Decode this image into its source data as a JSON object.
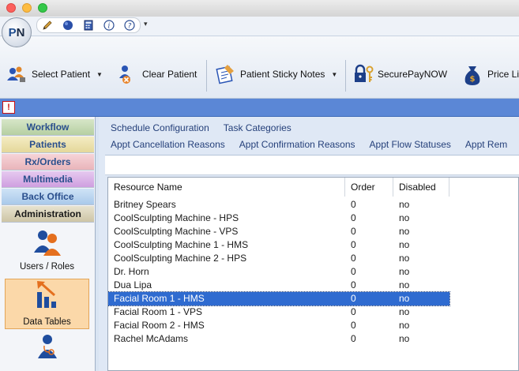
{
  "quick_access": {
    "icons": [
      "pen-icon",
      "globe-icon",
      "calculator-icon",
      "info-icon",
      "help-icon"
    ]
  },
  "ribbon": {
    "buttons": [
      {
        "label": "Select Patient",
        "icon": "select-patient-icon",
        "has_dropdown": true
      },
      {
        "label": "Clear Patient",
        "icon": "clear-patient-icon",
        "has_dropdown": false
      },
      {
        "label": "Patient Sticky Notes",
        "icon": "sticky-notes-icon",
        "has_dropdown": true
      },
      {
        "label": "SecurePayNOW",
        "icon": "lock-key-icon",
        "has_dropdown": false
      },
      {
        "label": "Price Li",
        "icon": "money-bag-icon",
        "has_dropdown": false
      }
    ]
  },
  "nav": {
    "sections": [
      "Workflow",
      "Patients",
      "Rx/Orders",
      "Multimedia",
      "Back Office",
      "Administration"
    ],
    "items": [
      {
        "label": "Users / Roles",
        "icon": "users-icon"
      },
      {
        "label": "Data Tables",
        "icon": "data-tables-icon",
        "selected": true
      },
      {
        "label": "",
        "icon": "provider-icon"
      }
    ]
  },
  "tabs": {
    "row1": [
      "Schedule Configuration",
      "Task Categories"
    ],
    "row2": [
      "Appt Cancellation Reasons",
      "Appt Confirmation Reasons",
      "Appt Flow Statuses",
      "Appt Rem"
    ]
  },
  "grid": {
    "columns": [
      "Resource Name",
      "Order",
      "Disabled"
    ],
    "rows": [
      {
        "name": "Britney Spears",
        "order": "0",
        "disabled": "no"
      },
      {
        "name": "CoolSculpting Machine - HPS",
        "order": "0",
        "disabled": "no"
      },
      {
        "name": "CoolSculpting Machine - VPS",
        "order": "0",
        "disabled": "no"
      },
      {
        "name": "CoolSculpting Machine 1 - HMS",
        "order": "0",
        "disabled": "no"
      },
      {
        "name": "CoolSculpting Machine 2 - HPS",
        "order": "0",
        "disabled": "no"
      },
      {
        "name": "Dr. Horn",
        "order": "0",
        "disabled": "no"
      },
      {
        "name": "Dua Lipa",
        "order": "0",
        "disabled": "no"
      },
      {
        "name": "Facial Room 1 - HMS",
        "order": "0",
        "disabled": "no",
        "selected": true
      },
      {
        "name": "Facial Room 1 - VPS",
        "order": "0",
        "disabled": "no"
      },
      {
        "name": "Facial Room 2 - HMS",
        "order": "0",
        "disabled": "no"
      },
      {
        "name": "Rachel McAdams",
        "order": "0",
        "disabled": "no"
      }
    ]
  },
  "colors": {
    "selection": "#2f6bd0",
    "alert_bar": "#5b87d6",
    "tab_text": "#25407a",
    "nav_selected": "#fbd8a9"
  }
}
